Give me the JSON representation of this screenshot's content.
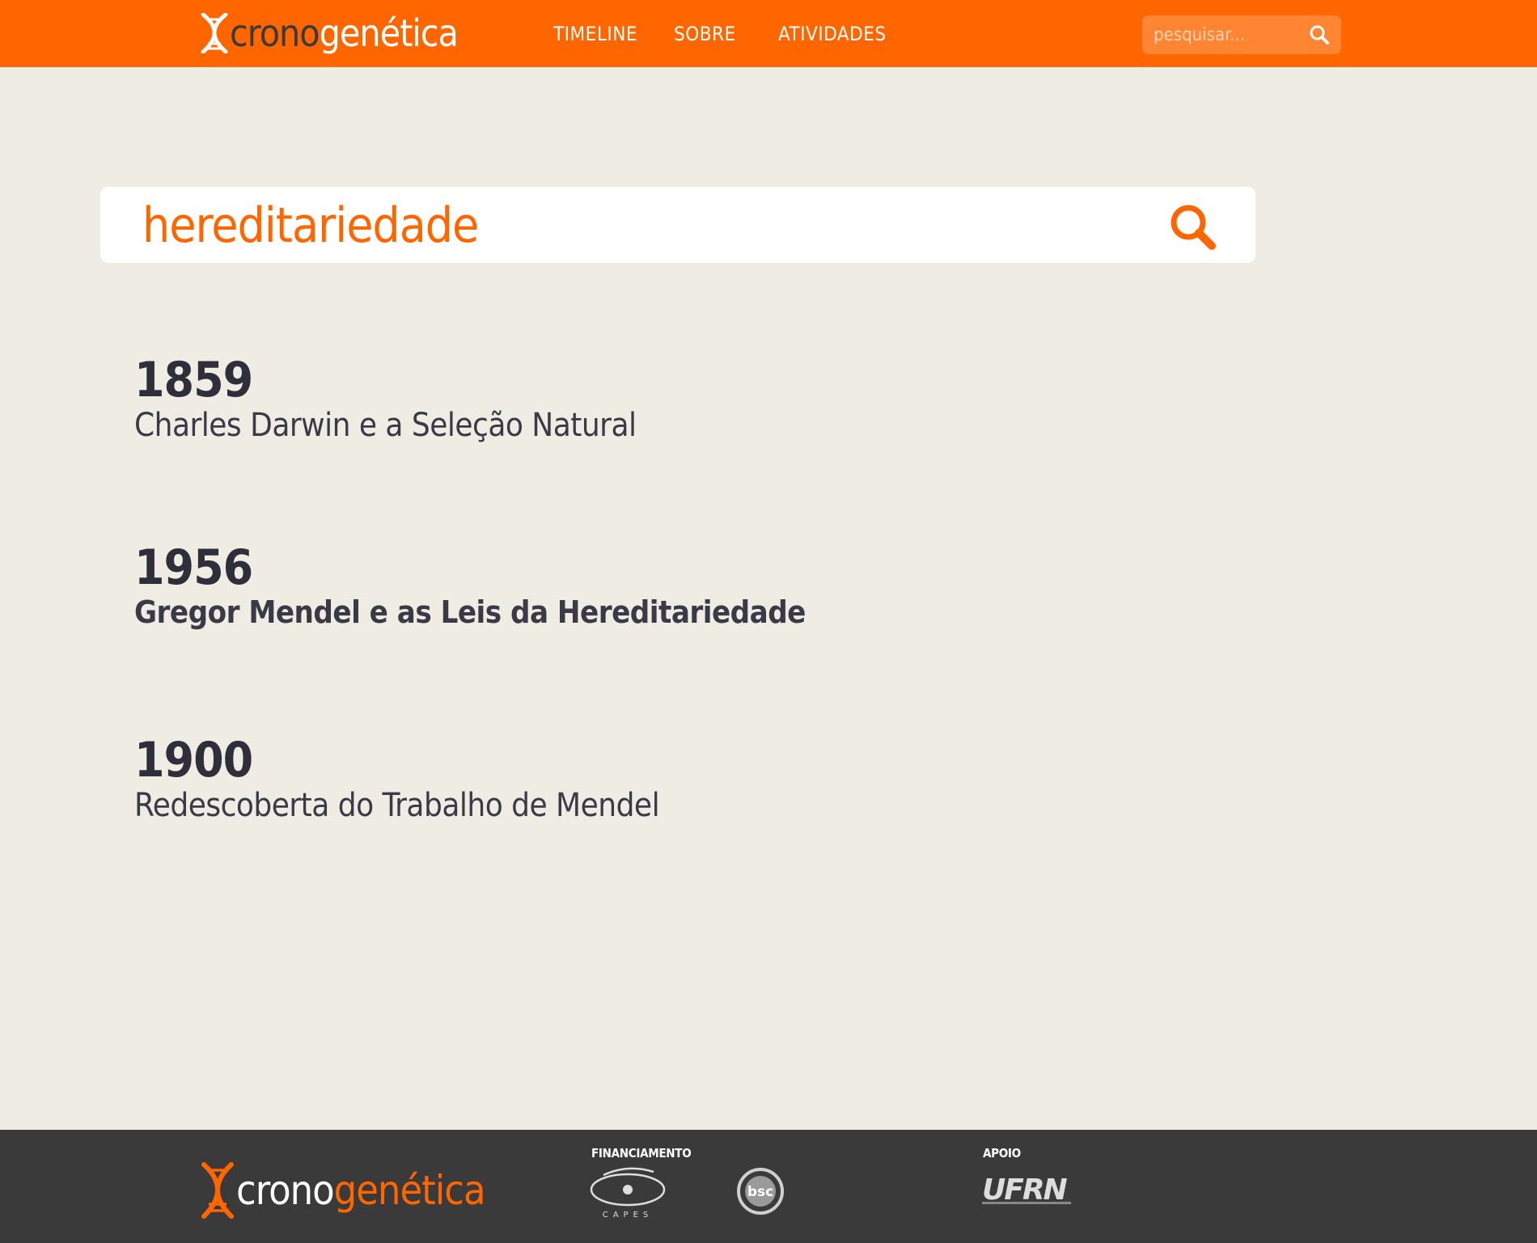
{
  "header": {
    "logo": {
      "part1": "crono",
      "part2": "genética"
    },
    "nav": [
      {
        "label": "TIMELINE"
      },
      {
        "label": "SOBRE"
      },
      {
        "label": "ATIVIDADES"
      }
    ],
    "search_placeholder": "pesquisar..."
  },
  "main_search": {
    "value": "hereditariedade"
  },
  "results": [
    {
      "year": "1859",
      "title": "Charles Darwin e a Seleção Natural"
    },
    {
      "year": "1956",
      "title": "Gregor Mendel e as Leis da Hereditariedade"
    },
    {
      "year": "1900",
      "title": "Redescoberta do Trabalho de Mendel"
    }
  ],
  "footer": {
    "logo": {
      "part1": "crono",
      "part2": "genética"
    },
    "funding_label": "FINANCIAMENTO",
    "support_label": "APOIO",
    "partners": {
      "capes": "CAPES",
      "bsc": "bsc",
      "ufrn": "UFRN"
    }
  },
  "colors": {
    "brand_orange": "#ff6600",
    "background": "#efece4",
    "footer_bg": "#3a3a3a",
    "text_dark": "#2f2f3b"
  }
}
